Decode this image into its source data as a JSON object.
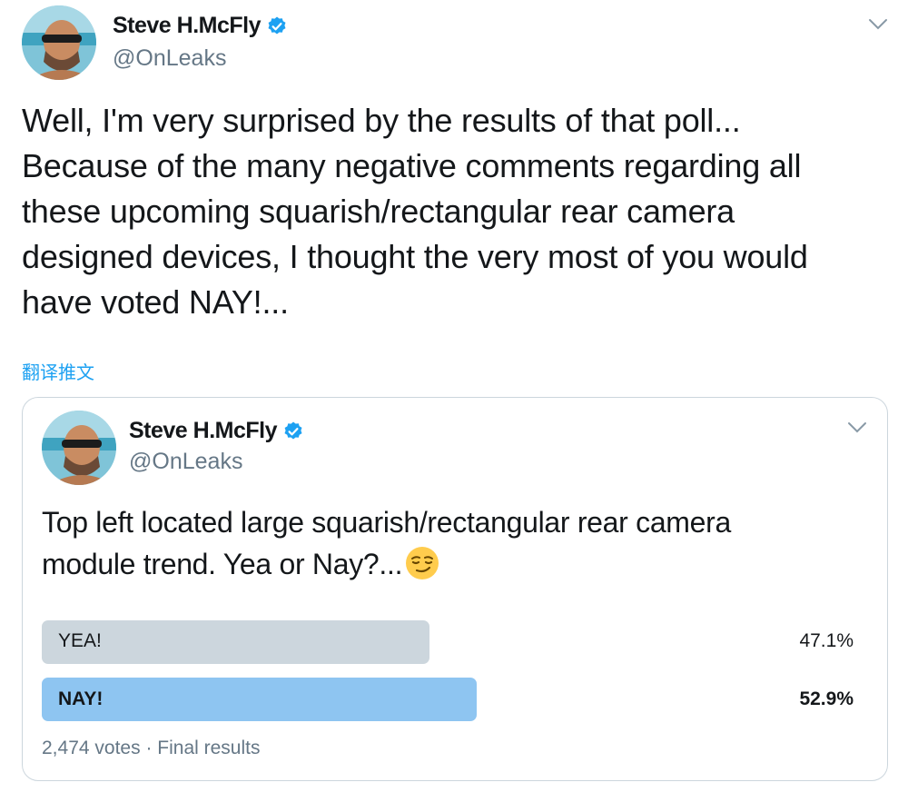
{
  "tweet": {
    "author": {
      "name": "Steve H.McFly",
      "handle": "@OnLeaks",
      "avatar_icon": "profile-photo",
      "verified": true
    },
    "text_lines": [
      "Well, I'm very surprised by the results of that poll...",
      "Because of the many negative comments regarding all",
      "these upcoming squarish/rectangular rear camera",
      "designed devices, I thought the very most of you would",
      "have voted NAY!..."
    ],
    "translate_label": "翻译推文",
    "menu_icon": "chevron-down-icon"
  },
  "quoted_tweet": {
    "author": {
      "name": "Steve H.McFly",
      "handle": "@OnLeaks",
      "avatar_icon": "profile-photo",
      "verified": true
    },
    "text_lines": [
      "Top left located large squarish/rectangular rear camera",
      "module trend. Yea or Nay?..."
    ],
    "emoji_icon": "smirking-face-emoji",
    "poll": {
      "options": [
        {
          "label": "YEA!",
          "percent_text": "47.1%",
          "percent": 47.1,
          "winner": false
        },
        {
          "label": "NAY!",
          "percent_text": "52.9%",
          "percent": 52.9,
          "winner": true
        }
      ],
      "votes_text": "2,474 votes",
      "separator": "·",
      "status_text": "Final results"
    }
  },
  "colors": {
    "accent": "#1da1f2",
    "text_primary": "#14171a",
    "text_secondary": "#657786",
    "poll_bar_loser": "#ccd6dd",
    "poll_bar_winner": "#8ec5f1",
    "card_border": "#ccd6dd"
  }
}
